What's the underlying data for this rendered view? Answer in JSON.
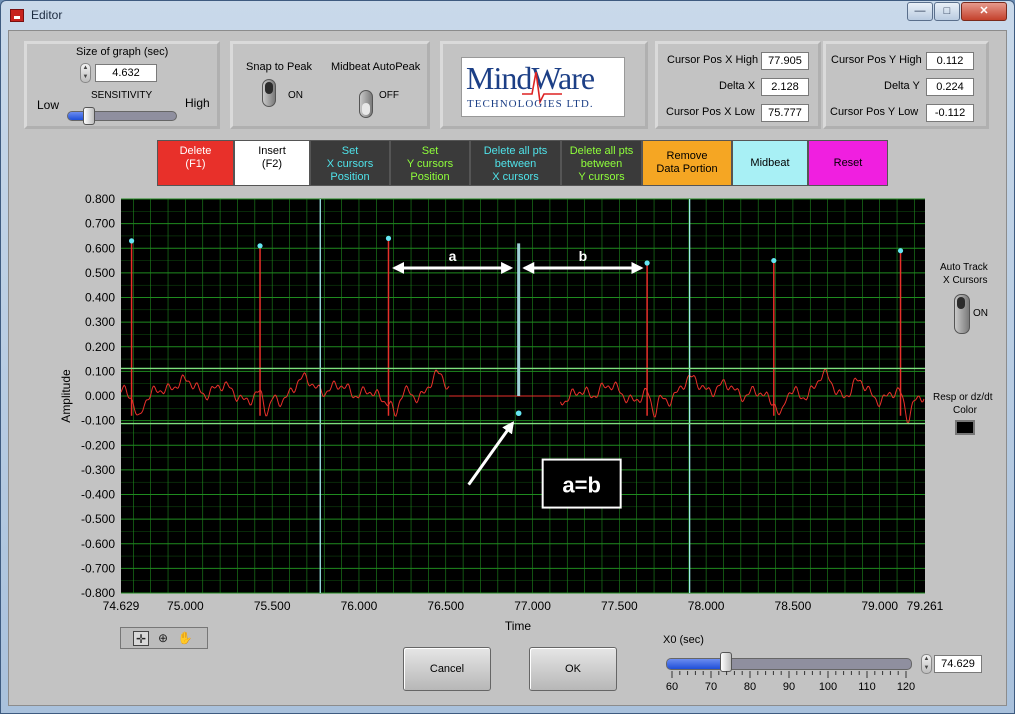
{
  "window": {
    "title": "Editor",
    "min_label": "—",
    "max_label": "□",
    "close_label": "✕"
  },
  "size_of_graph": {
    "label": "Size of graph (sec)",
    "value": "4.632"
  },
  "sensitivity": {
    "label": "SENSITIVITY",
    "low_label": "Low",
    "high_label": "High",
    "level": 0.2
  },
  "snap_to_peak": {
    "label": "Snap to Peak",
    "state": "ON"
  },
  "midbeat_autopeak": {
    "label": "Midbeat AutoPeak",
    "state": "OFF"
  },
  "logo": {
    "main": "MindWare",
    "sub": "TECHNOLOGIES LTD."
  },
  "cursor_x": {
    "high_label": "Cursor Pos X High",
    "high_value": "77.905",
    "delta_label": "Delta X",
    "delta_value": "2.128",
    "low_label": "Cursor Pos X Low",
    "low_value": "75.777"
  },
  "cursor_y": {
    "high_label": "Cursor Pos Y High",
    "high_value": "0.112",
    "delta_label": "Delta Y",
    "delta_value": "0.224",
    "low_label": "Cursor Pos Y Low",
    "low_value": "-0.112"
  },
  "toolbar": [
    {
      "line1": "Delete",
      "line2": "(F1)",
      "line3": "",
      "bg": "#e8302a",
      "fg": "#ffffff"
    },
    {
      "line1": "Insert",
      "line2": "(F2)",
      "line3": "",
      "bg": "#ffffff",
      "fg": "#000000"
    },
    {
      "line1": "Set",
      "line2": "X cursors",
      "line3": "Position",
      "bg": "#3a3a3a",
      "fg": "#4fe3ea"
    },
    {
      "line1": "Set",
      "line2": "Y cursors",
      "line3": "Position",
      "bg": "#3a3a3a",
      "fg": "#8fff3a"
    },
    {
      "line1": "Delete all pts",
      "line2": "between",
      "line3": "X cursors",
      "bg": "#3a3a3a",
      "fg": "#4fe3ea"
    },
    {
      "line1": "Delete all pts",
      "line2": "between",
      "line3": "Y cursors",
      "bg": "#3a3a3a",
      "fg": "#8fff3a"
    },
    {
      "line1": "Remove",
      "line2": "Data Portion",
      "line3": "",
      "bg": "#f5a623",
      "fg": "#000000"
    },
    {
      "line1": "Midbeat",
      "line2": "",
      "line3": "",
      "bg": "#a8f0f5",
      "fg": "#000000"
    },
    {
      "line1": "Reset",
      "line2": "",
      "line3": "",
      "bg": "#f01fe0",
      "fg": "#000000"
    }
  ],
  "chart_data": {
    "type": "line",
    "ylabel": "Amplitude",
    "xlabel": "Time",
    "xlim": [
      74.629,
      79.261
    ],
    "ylim": [
      -0.8,
      0.8
    ],
    "xticks": [
      "74.629",
      "75.000",
      "75.500",
      "76.000",
      "76.500",
      "77.000",
      "77.500",
      "78.000",
      "78.500",
      "79.000",
      "79.261"
    ],
    "yticks": [
      "0.800",
      "0.700",
      "0.600",
      "0.500",
      "0.400",
      "0.300",
      "0.200",
      "0.100",
      "0.000",
      "-0.100",
      "-0.200",
      "-0.300",
      "-0.400",
      "-0.500",
      "-0.600",
      "-0.700",
      "-0.800"
    ],
    "grid": true,
    "colors": {
      "background": "#000000",
      "grid": "#1f8a1f",
      "signal": "#e8302a",
      "peak": "#66e6f2",
      "x_cursor": "#9fe8ea",
      "y_cursor": "#7ee07e",
      "midbeat_line": "#9fd0d6"
    },
    "x_cursors": [
      75.777,
      77.905
    ],
    "y_cursors": [
      0.112,
      -0.112
    ],
    "peaks": [
      {
        "x": 74.69,
        "y": 0.63
      },
      {
        "x": 75.43,
        "y": 0.61
      },
      {
        "x": 76.17,
        "y": 0.64
      },
      {
        "x": 77.66,
        "y": 0.54
      },
      {
        "x": 78.39,
        "y": 0.55
      },
      {
        "x": 79.12,
        "y": 0.59
      }
    ],
    "midbeat": {
      "x": 76.92,
      "y": -0.07
    },
    "annotations": {
      "a_label": "a",
      "b_label": "b",
      "equation": "a=b"
    }
  },
  "auto_track": {
    "label_line1": "Auto Track",
    "label_line2": "X Cursors",
    "state": "ON"
  },
  "resp_color": {
    "label_line1": "Resp or dz/dt",
    "label_line2": "Color",
    "swatch": "#000000"
  },
  "tools": {
    "cursor": "✛",
    "zoom": "⊕",
    "pan": "✋"
  },
  "buttons": {
    "cancel": "Cancel",
    "ok": "OK"
  },
  "x0": {
    "label": "X0 (sec)",
    "value": "74.629",
    "min": 60,
    "max": 120,
    "level": 74.629,
    "ticks": [
      "60",
      "70",
      "80",
      "90",
      "100",
      "110",
      "120"
    ]
  }
}
